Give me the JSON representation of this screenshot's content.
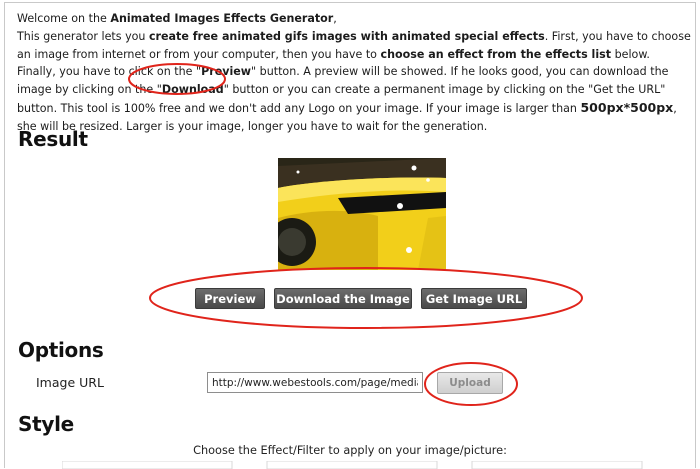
{
  "intro": {
    "welcome_prefix": "Welcome on the ",
    "welcome_bold": "Animated Images Effects Generator",
    "welcome_suffix": ",",
    "p1": "This generator lets you ",
    "p1_bold": "create free animated gifs images with animated special effects",
    "p2": ". First, you have to choose an image from internet or from your computer, then you have to ",
    "p2_bold": "choose an effect from the effects list",
    "p3": " below. Finally, you have to click on the \"",
    "p3_bold": "Preview",
    "p4": "\" button. A preview will be showed. If he looks good, you can download the image by clicking on the \"",
    "p4_bold": "Download",
    "p5": "\" button or you can create a permanent image by clicking on the \"Get the URL\" button. This tool is 100% free and we don't add any Logo on your image. If your image is larger than ",
    "p5_bold": "500px*500px",
    "p6": ", she will be resized. Larger is your image, longer you have to wait for the generation."
  },
  "sections": {
    "result": "Result",
    "options": "Options",
    "style": "Style"
  },
  "buttons": {
    "preview": "Preview",
    "download": "Download the Image",
    "get_url": "Get Image URL",
    "upload": "Upload"
  },
  "options": {
    "image_url_label": "Image URL",
    "image_url_value": "http://www.webestools.com/page/media/in"
  },
  "style": {
    "choose_text": "Choose the Effect/Filter to apply on your image/picture:"
  },
  "colors": {
    "annotation": "#e0241b",
    "button_dark": "#555555",
    "car_yellow": "#f4d21c"
  }
}
